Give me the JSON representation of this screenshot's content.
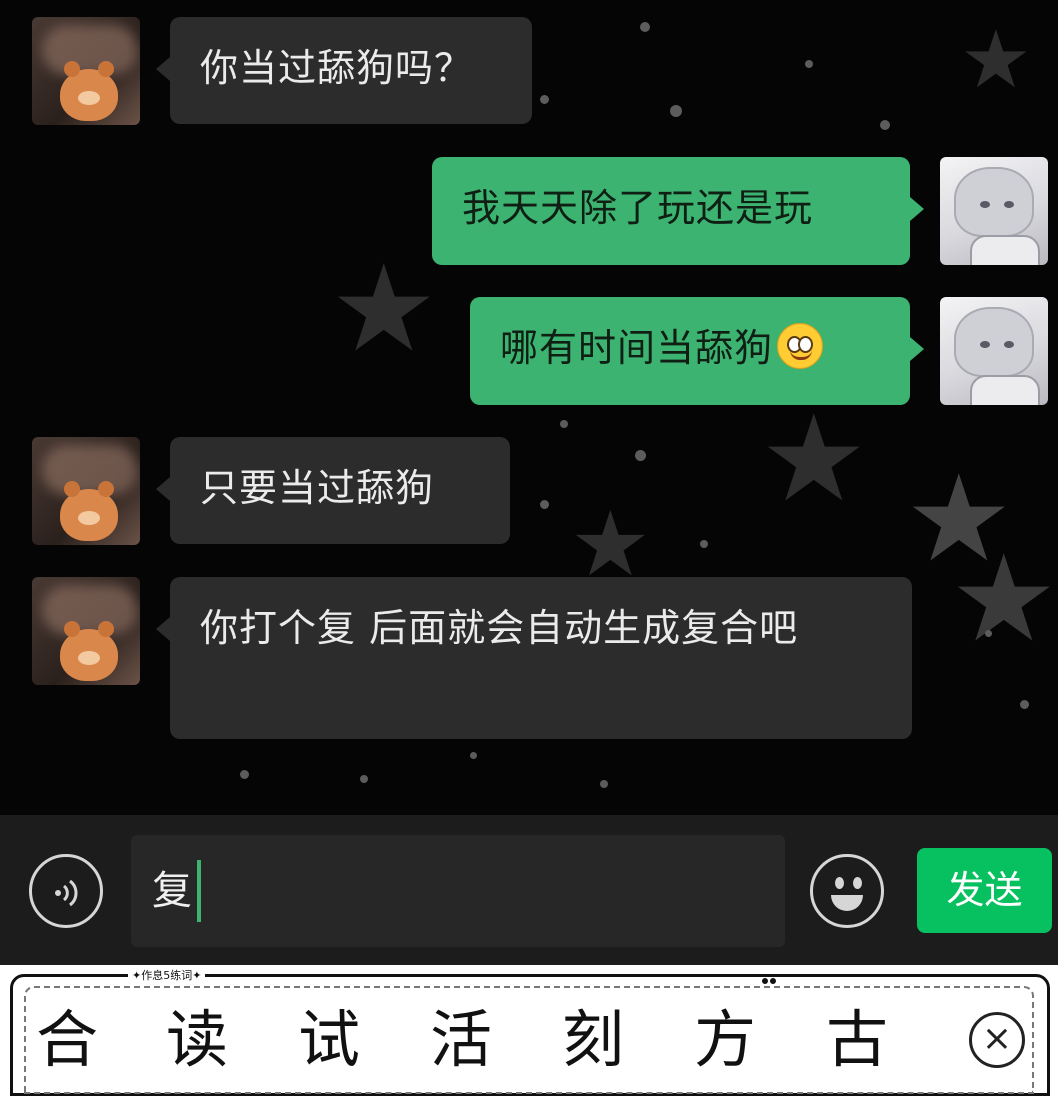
{
  "messages": [
    {
      "side": "left",
      "text": "你当过舔狗吗？"
    },
    {
      "side": "right",
      "text": "我天天除了玩还是玩"
    },
    {
      "side": "right",
      "text": "哪有时间当舔狗",
      "emoji": "smile-emoji"
    },
    {
      "side": "left",
      "text": "只要当过舔狗"
    },
    {
      "side": "left",
      "text": "你打个复  后面就会自动生成复合吧"
    }
  ],
  "input": {
    "value": "复"
  },
  "send_label": "发送",
  "keyboard": {
    "header": "✦作息5练词✦",
    "candidates": [
      "合",
      "读",
      "试",
      "活",
      "刻",
      "方",
      "古"
    ]
  },
  "colors": {
    "sent_bubble": "#3cb371",
    "received_bubble": "#2c2c2c",
    "send_button": "#07c160"
  },
  "icons": [
    "voice-icon",
    "emoji-icon",
    "close-icon"
  ]
}
